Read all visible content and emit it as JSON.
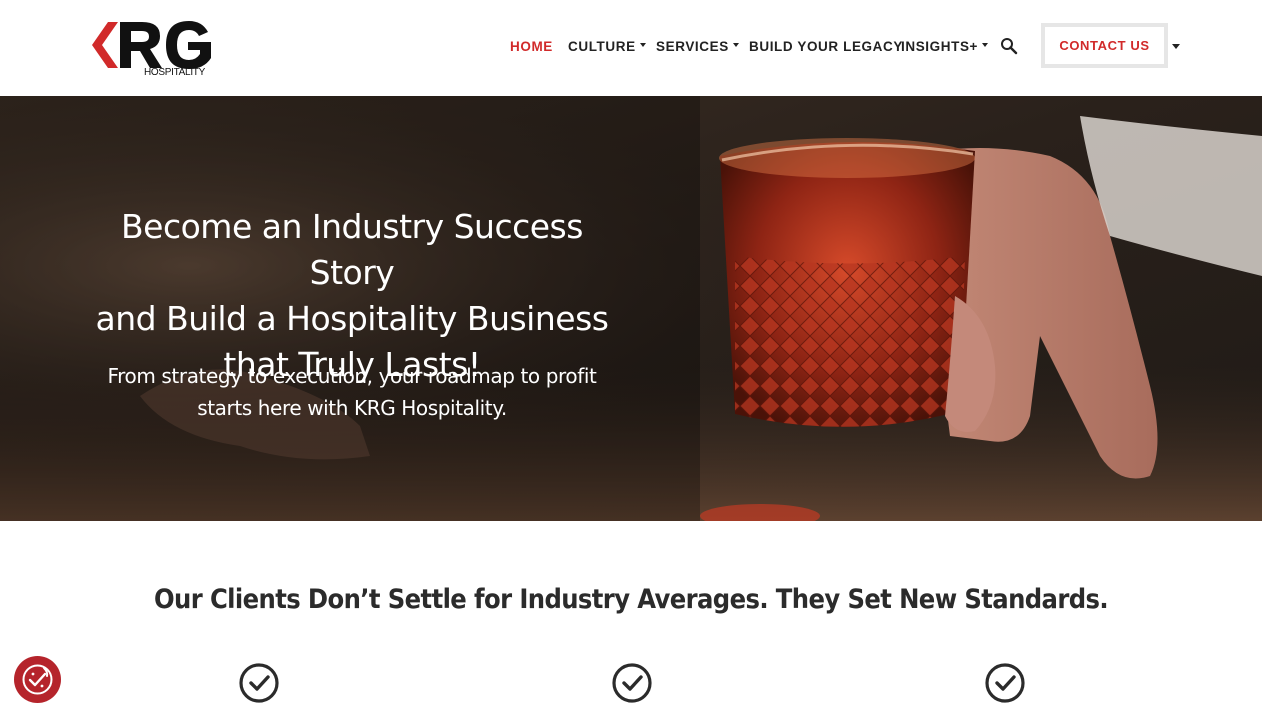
{
  "brand": {
    "logo_text": "KRG",
    "logo_sub": "HOSPITALITY",
    "accent_color": "#d12a2a",
    "logo_chevron_color": "#d12a2a"
  },
  "nav": {
    "items": [
      {
        "label": "HOME",
        "active": true,
        "has_dropdown": false
      },
      {
        "label": "CULTURE",
        "active": false,
        "has_dropdown": true
      },
      {
        "label": "SERVICES",
        "active": false,
        "has_dropdown": true
      },
      {
        "label": "BUILD YOUR LEGACY",
        "active": false,
        "has_dropdown": false
      },
      {
        "label": "INSIGHTS+",
        "active": false,
        "has_dropdown": true
      }
    ],
    "search_icon": "search-icon",
    "contact_label": "CONTACT US"
  },
  "hero": {
    "title_line1": "Become an Industry Success Story",
    "title_line2": "and Build a Hospitality Business",
    "title_line3": "that Truly Lasts!",
    "subtitle_line1": "From strategy to execution, your roadmap to profit",
    "subtitle_line2": "starts here with KRG Hospitality."
  },
  "section": {
    "heading": "Our Clients Don’t Settle for Industry Averages. They Set New Standards.",
    "check_icons": [
      "check-circle-icon",
      "check-circle-icon",
      "check-circle-icon"
    ]
  },
  "cookie": {
    "icon": "cookie-consent-icon",
    "color": "#b5242b"
  }
}
